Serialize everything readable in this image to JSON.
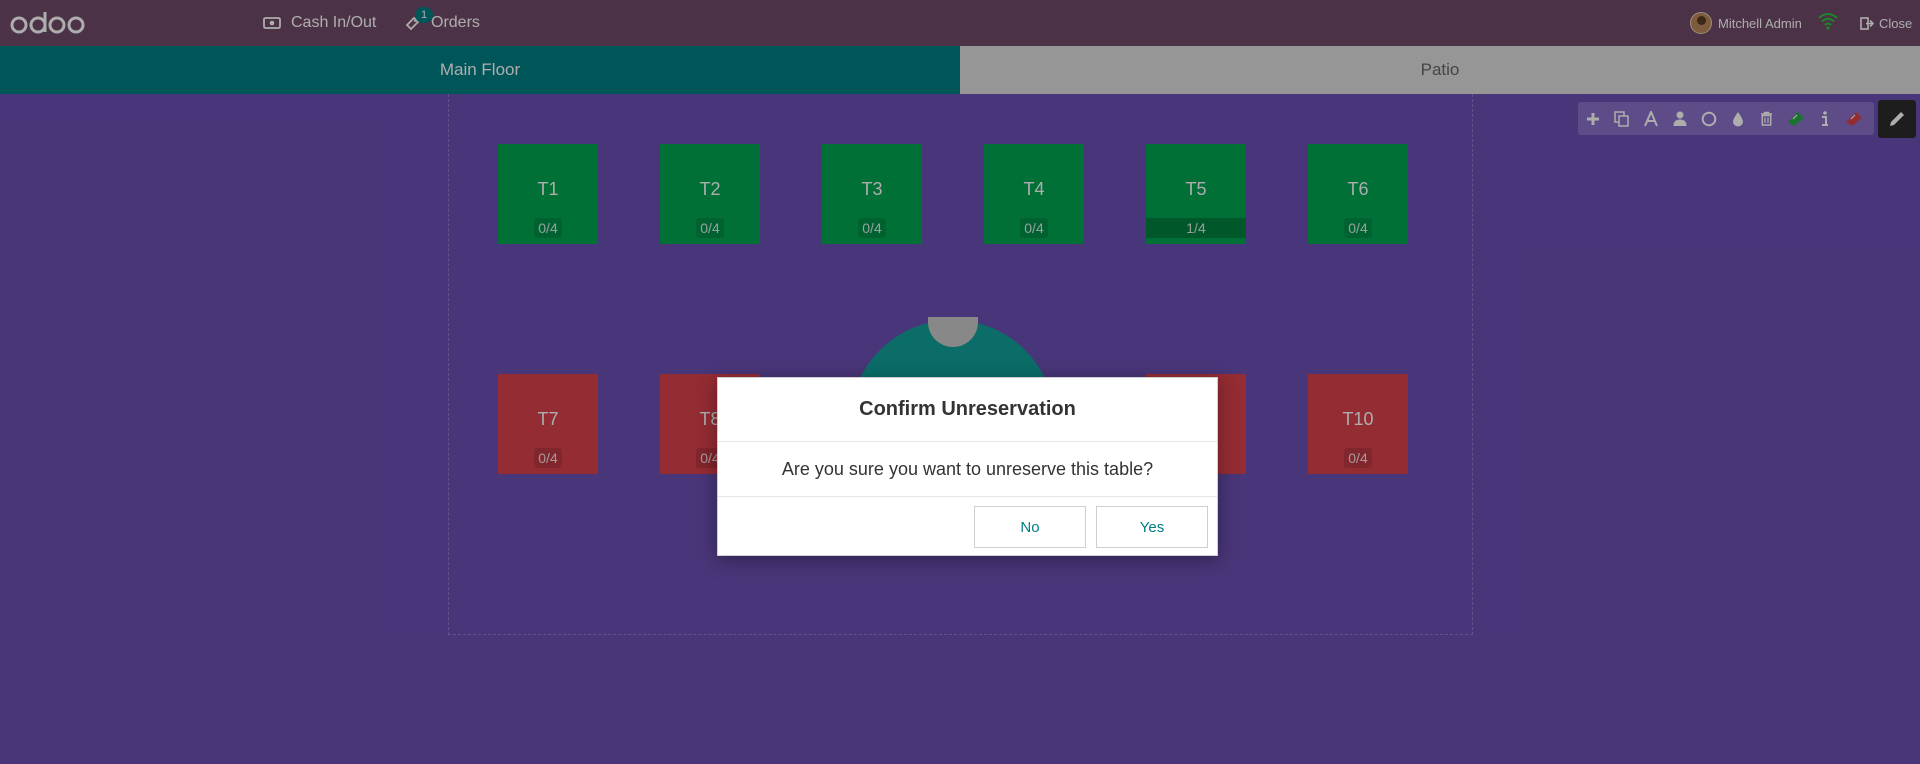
{
  "navbar": {
    "logo_text": "odoo",
    "cash_label": "Cash In/Out",
    "orders_label": "Orders",
    "orders_badge": "1",
    "user_name": "Mitchell Admin",
    "close_label": "Close"
  },
  "floors": {
    "main": "Main Floor",
    "patio": "Patio"
  },
  "tables": [
    {
      "name": "T1",
      "count": "0/4"
    },
    {
      "name": "T2",
      "count": "0/4"
    },
    {
      "name": "T3",
      "count": "0/4"
    },
    {
      "name": "T4",
      "count": "0/4"
    },
    {
      "name": "T5",
      "count": "1/4"
    },
    {
      "name": "T6",
      "count": "0/4"
    },
    {
      "name": "T7",
      "count": "0/4"
    },
    {
      "name": "T8",
      "count": "0/4"
    },
    {
      "name": "T10",
      "count": "0/4"
    }
  ],
  "modal": {
    "title": "Confirm Unreservation",
    "body": "Are you sure you want to unreserve this table?",
    "no_label": "No",
    "yes_label": "Yes"
  },
  "colors": {
    "navbar": "#714b67",
    "accent": "#017e84",
    "table_free": "#00a651",
    "table_reserved": "#d9414c",
    "floor_background": "#6c4fb3"
  },
  "icons": {
    "toolbar": [
      "plus-icon",
      "copy-icon",
      "font-icon",
      "user-icon",
      "circle-icon",
      "tint-icon",
      "trash-icon",
      "ticket-green-icon",
      "info-icon",
      "ticket-red-icon"
    ],
    "edit": "pencil-icon"
  }
}
